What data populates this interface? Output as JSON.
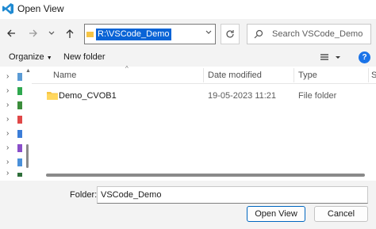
{
  "window": {
    "title": "Open View",
    "app_icon": "vscode-icon"
  },
  "nav": {
    "back_icon": "arrow-left-icon",
    "forward_icon": "arrow-right-icon",
    "recent_icon": "chevron-down-icon",
    "up_icon": "arrow-up-icon",
    "address": "R:\\VSCode_Demo",
    "refresh_icon": "refresh-icon",
    "search_placeholder": "Search VSCode_Demo"
  },
  "toolbar": {
    "organize": "Organize",
    "new_folder": "New folder",
    "help": "?"
  },
  "columns": {
    "name": "Name",
    "date": "Date modified",
    "type": "Type",
    "size": "S"
  },
  "files": [
    {
      "name": "Demo_CVOB1",
      "date": "19-05-2023 11:21",
      "type": "File folder"
    }
  ],
  "footer": {
    "folder_label": "Folder:",
    "folder_value": "VSCode_Demo",
    "open_label": "Open View",
    "cancel_label": "Cancel"
  },
  "colors": {
    "accent": "#0a64d6",
    "folder": "#f6c444",
    "chrome": "#f3f3f3"
  }
}
